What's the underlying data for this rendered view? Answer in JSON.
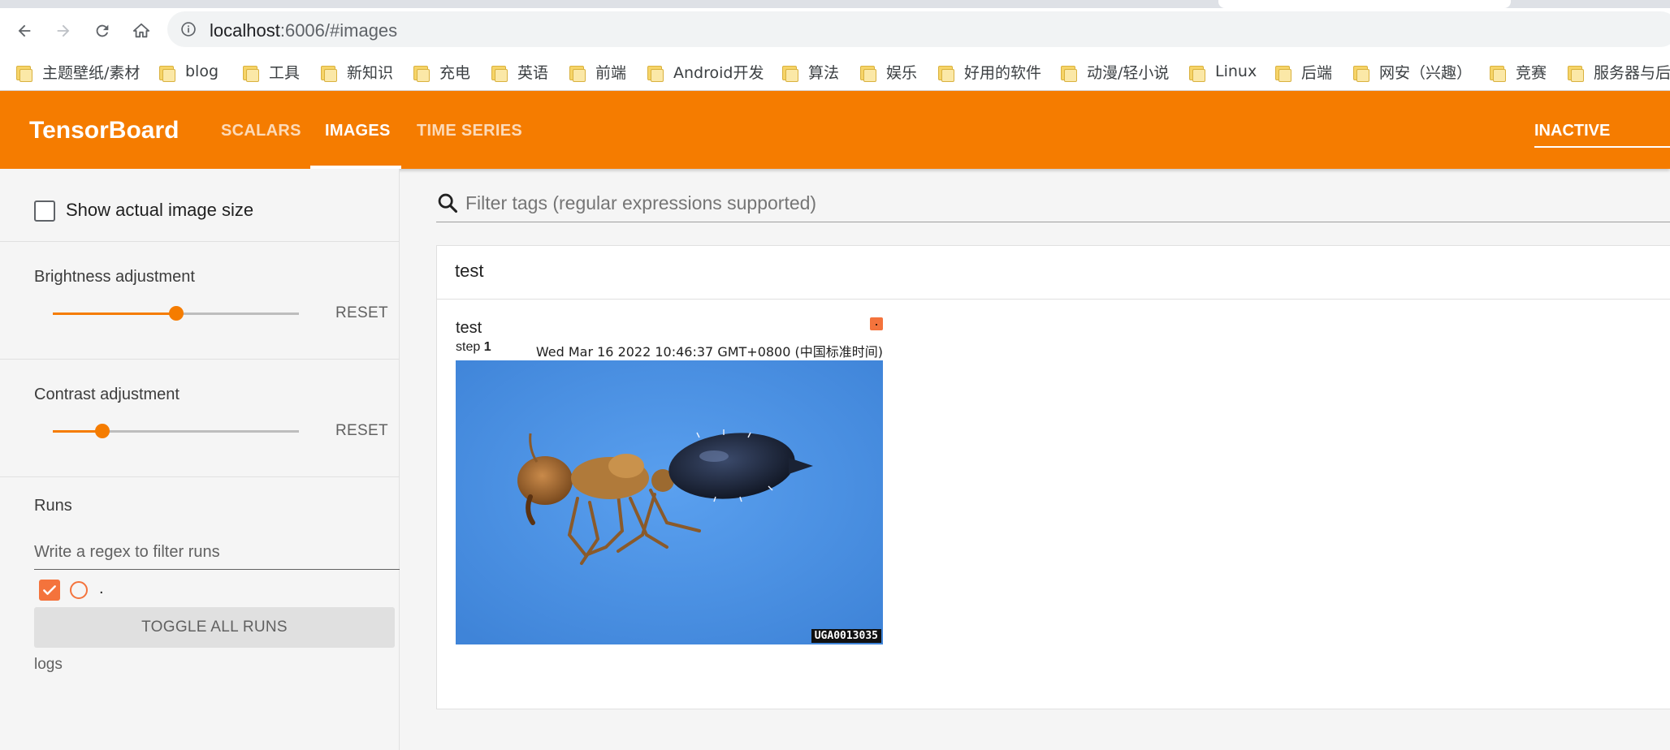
{
  "browser": {
    "url_host": "localhost",
    "url_path": ":6006/#images",
    "bookmarks": [
      "主题壁纸/素材",
      "blog",
      "工具",
      "新知识",
      "充电",
      "英语",
      "前端",
      "Android开发",
      "算法",
      "娱乐",
      "好用的软件",
      "动漫/轻小说",
      "Linux",
      "后端",
      "网安（兴趣）",
      "竞赛",
      "服务器与后端"
    ]
  },
  "header": {
    "brand": "TensorBoard",
    "tabs": [
      "SCALARS",
      "IMAGES",
      "TIME SERIES"
    ],
    "active_tab": "IMAGES",
    "status": "INACTIVE",
    "accent": "#f57c00"
  },
  "sidebar": {
    "show_actual_size_label": "Show actual image size",
    "brightness": {
      "title": "Brightness adjustment",
      "reset": "RESET",
      "value": 0.5
    },
    "contrast": {
      "title": "Contrast adjustment",
      "reset": "RESET",
      "value": 0.2
    },
    "runs": {
      "title": "Runs",
      "filter_placeholder": "Write a regex to filter runs",
      "run_name": ".",
      "run_color": "#f4733c",
      "toggle_label": "TOGGLE ALL RUNS",
      "logdir": "logs"
    }
  },
  "main": {
    "filter_placeholder": "Filter tags (regular expressions supported)",
    "card_title": "test",
    "image": {
      "tag": "test",
      "step_label": "step",
      "step_value": "1",
      "timestamp": "Wed Mar 16 2022 10:46:37 GMT+0800 (中国标准时间)",
      "watermark": "UGA0013035"
    }
  }
}
